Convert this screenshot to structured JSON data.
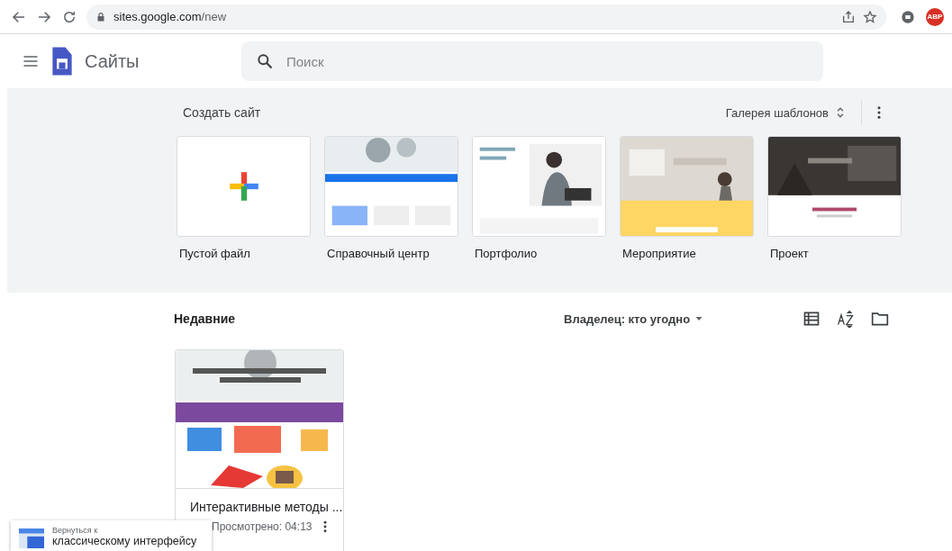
{
  "browser": {
    "url_host": "sites.google.com",
    "url_path": "/new",
    "extension_badge": "ABP"
  },
  "header": {
    "app_name": "Сайты",
    "search": {
      "placeholder": "Поиск"
    }
  },
  "gallery": {
    "title": "Создать сайт",
    "gallery_button": "Галерея шаблонов",
    "templates": [
      {
        "kind": "blank",
        "label": "Пустой файл"
      },
      {
        "kind": "picture",
        "label": "Справочный центр"
      },
      {
        "kind": "picture",
        "label": "Портфолио"
      },
      {
        "kind": "picture",
        "label": "Мероприятие"
      },
      {
        "kind": "picture",
        "label": "Проект"
      }
    ]
  },
  "recent": {
    "title": "Недавние",
    "owner_filter": "Владелец: кто угодно",
    "files": [
      {
        "title": "Интерактивные методы ...",
        "meta": "Просмотрено: 04:13"
      }
    ]
  },
  "toast": {
    "line_1": "Вернуться к",
    "line_2": "классическому интерфейсу"
  }
}
